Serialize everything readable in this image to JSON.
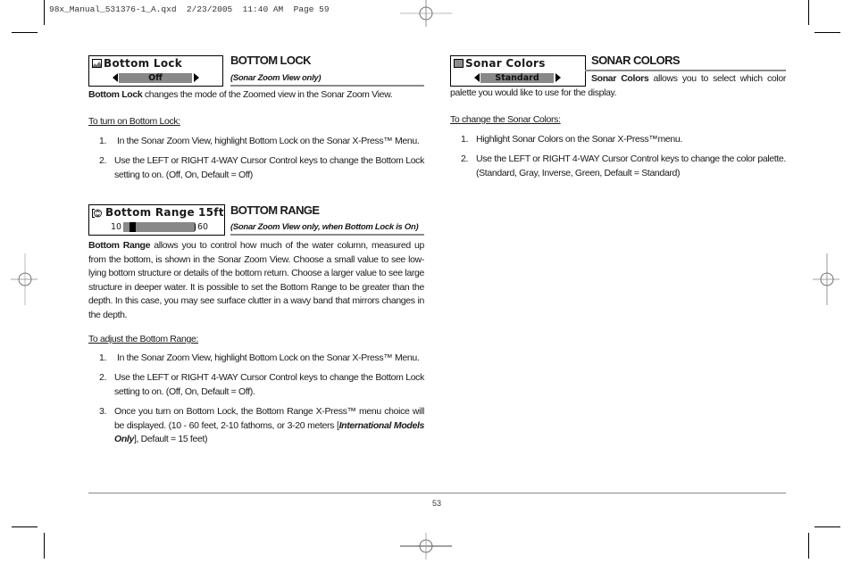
{
  "slug": "98x_Manual_531376-1_A.qxd  2/23/2005  11:40 AM  Page 59",
  "page_number": "53",
  "bottom_lock": {
    "menu": {
      "title": "Bottom Lock",
      "value": "Off",
      "icon": "bottom-lock-icon"
    },
    "title": "BOTTOM LOCK",
    "subtitle": "(Sonar Zoom View only)",
    "intro_bold": "Bottom Lock",
    "intro_rest": " changes the mode of the Zoomed view in the Sonar Zoom View.",
    "procedure_title": "To turn on Bottom Lock:",
    "steps": [
      {
        "num": "1.",
        "text": "In the Sonar Zoom View, highlight Bottom Lock on the Sonar X-Press™ Menu."
      },
      {
        "num": "2.",
        "text": "Use the LEFT or RIGHT 4-WAY Cursor Control keys to change the Bottom Lock setting to on. (Off, On, Default = Off)"
      }
    ]
  },
  "bottom_range": {
    "menu": {
      "title": "Bottom Range",
      "value": "15ft",
      "min": "10",
      "max": "60",
      "slider_fraction": 0.1,
      "icon": "bottom-range-icon"
    },
    "title": "BOTTOM RANGE",
    "subtitle": "(Sonar Zoom View only, when Bottom Lock is On)",
    "intro_bold": "Bottom Range",
    "intro_rest": " allows you to control how much of the water column, measured up from the bottom, is shown in the Sonar Zoom View. Choose a small value to see low-lying bottom structure or details of the bottom return.  Choose a larger value to see large structure in deeper water.  It is possible to set the Bottom Range to be greater than the depth.  In this case, you may see surface clutter in a wavy band that mirrors changes in the depth.",
    "procedure_title": "To adjust the Bottom Range:",
    "steps": [
      {
        "num": "1.",
        "text": "In the Sonar Zoom View, highlight Bottom Lock on the Sonar X-Press™ Menu."
      },
      {
        "num": "2.",
        "text": "Use the LEFT or RIGHT 4-WAY Cursor Control keys to change the Bottom Lock setting to on. (Off, On, Default = Off)."
      }
    ],
    "step3": {
      "num": "3.",
      "pre": "Once you turn on Bottom Lock, the Bottom Range X-Press™ menu choice will be displayed. (10 - 60 feet, 2-10 fathoms, or 3-20 meters [",
      "italic": "International Models Only",
      "post": "], Default = 15 feet)"
    }
  },
  "sonar_colors": {
    "menu": {
      "title": "Sonar Colors",
      "value": "Standard",
      "icon": "sonar-colors-icon"
    },
    "title": "SONAR COLORS",
    "intro_bold": "Sonar Colors",
    "intro_rest": " allows you to select which color palette you would like to use for the display.",
    "procedure_title": "To change the Sonar Colors:",
    "steps": [
      {
        "num": "1.",
        "text": "Highlight Sonar Colors on the Sonar X-Press™menu."
      },
      {
        "num": "2.",
        "text": "Use the LEFT or RIGHT 4-WAY Cursor Control keys to change the color palette. (Standard, Gray, Inverse, Green, Default = Standard)"
      }
    ]
  }
}
